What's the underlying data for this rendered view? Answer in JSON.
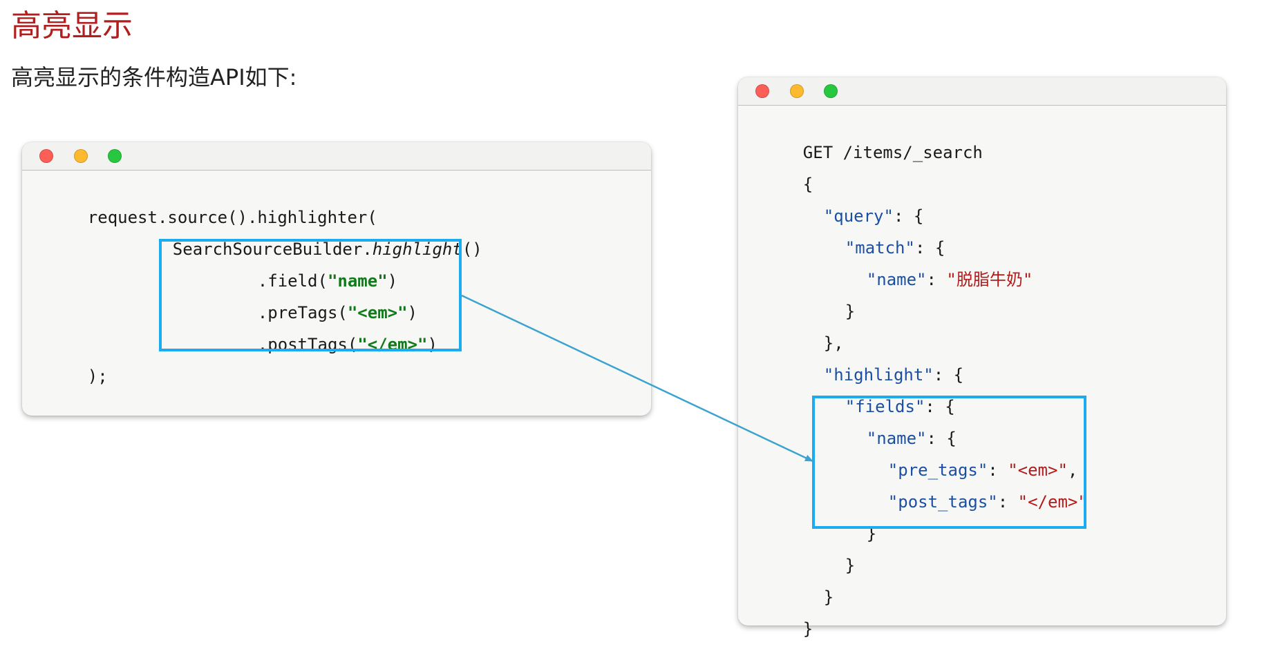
{
  "title": "高亮显示",
  "subtitle": "高亮显示的条件构造API如下:",
  "java_code": {
    "line1": "request.source().highlighter(",
    "line2_prefix": "SearchSourceBuilder.",
    "line2_method": "highlight",
    "line2_suffix": "()",
    "line3_prefix": ".field(",
    "line3_arg": "\"name\"",
    "line3_suffix": ")",
    "line4_prefix": ".preTags(",
    "line4_arg": "\"<em>\"",
    "line4_suffix": ")",
    "line5_prefix": ".postTags(",
    "line5_arg": "\"</em>\"",
    "line5_suffix": ")",
    "line6": ");"
  },
  "dsl_code": {
    "line1": "GET /items/_search",
    "open_brace": "{",
    "query_key": "\"query\"",
    "query_rest": ": {",
    "match_key": "\"match\"",
    "match_rest": ": {",
    "name_key": "\"name\"",
    "name_sep": ": ",
    "name_value": "\"脱脂牛奶\"",
    "close_brace": "}",
    "close_brace_comma": "},",
    "highlight_key": "\"highlight\"",
    "highlight_rest": ": {",
    "fields_key": "\"fields\"",
    "fields_rest": ": {",
    "field_name_key": "\"name\"",
    "field_name_rest": ": {",
    "pre_tags_key": "\"pre_tags\"",
    "pre_tags_sep": ": ",
    "pre_tags_value": "\"<em>\"",
    "pre_tags_comma": ",",
    "post_tags_key": "\"post_tags\"",
    "post_tags_sep": ": ",
    "post_tags_value": "\"</em>\""
  },
  "colors": {
    "title": "#b01e1e",
    "highlight_box": "#1aacee",
    "connector_arrow": "#3aa3cf",
    "java_string": "#117a1b",
    "json_key": "#1a4fa3",
    "json_string": "#b31a1a"
  }
}
